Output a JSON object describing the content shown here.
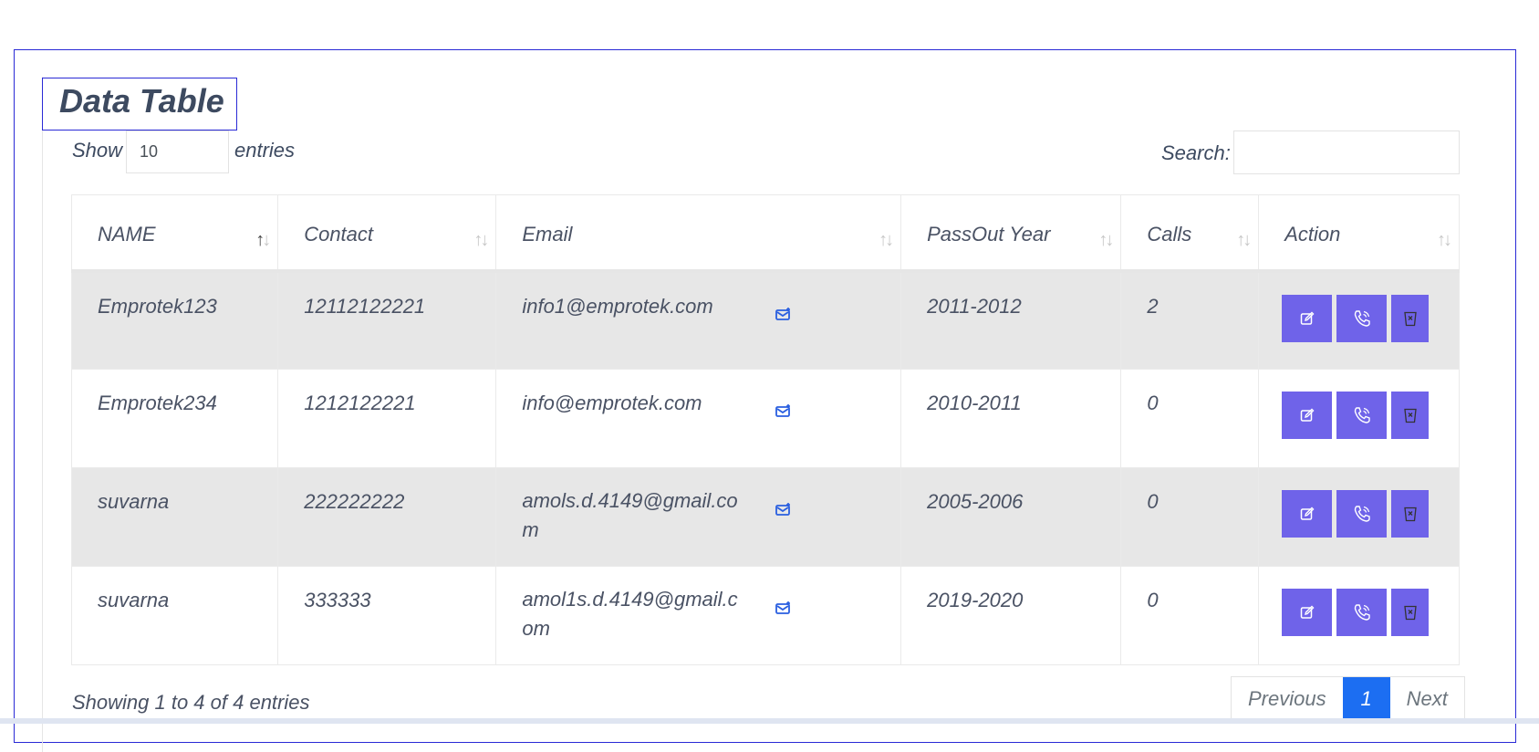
{
  "page": {
    "title": "Data Table"
  },
  "controls": {
    "show_label": "Show",
    "entries_value": "10",
    "entries_label": "entries",
    "search_label": "Search:",
    "search_value": ""
  },
  "table": {
    "columns": [
      "NAME",
      "Contact",
      "Email",
      "PassOut Year",
      "Calls",
      "Action"
    ],
    "sorted_column": "NAME",
    "sort_direction": "asc",
    "rows": [
      {
        "name": "Emprotek123",
        "contact": "12112122221",
        "email": "info1@emprotek.com",
        "year": "2011-2012",
        "calls": "2"
      },
      {
        "name": "Emprotek234",
        "contact": "1212122221",
        "email": "info@emprotek.com",
        "year": "2010-2011",
        "calls": "0"
      },
      {
        "name": "suvarna",
        "contact": "222222222",
        "email": "amols.d.4149@gmail.com",
        "year": "2005-2006",
        "calls": "0"
      },
      {
        "name": "suvarna",
        "contact": "333333",
        "email": "amol1s.d.4149@gmail.com",
        "year": "2019-2020",
        "calls": "0"
      }
    ],
    "action_icons": [
      "edit-icon",
      "phone-call-icon",
      "trash-icon"
    ],
    "email_icon": "mail-add-icon"
  },
  "footer": {
    "info": "Showing 1 to 4 of 4 entries",
    "previous": "Previous",
    "current_page": "1",
    "next": "Next"
  },
  "colors": {
    "action_button": "#6f63e9",
    "active_page": "#1c6ef2",
    "mail_icon": "#2a5fe0",
    "odd_row": "#e7e7e7",
    "frame_border": "#2a2ad6"
  }
}
